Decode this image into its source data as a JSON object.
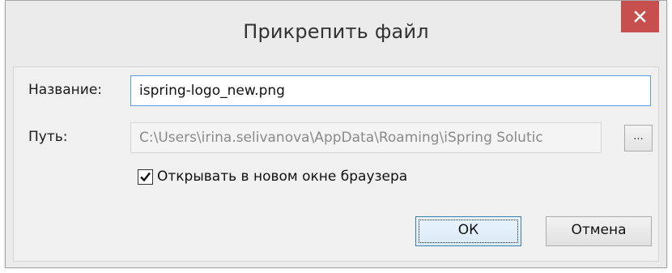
{
  "dialog": {
    "title": "Прикрепить файл",
    "close_icon": "close-icon",
    "accent_close": "#c7504e"
  },
  "form": {
    "name_label": "Название:",
    "name_value": "ispring-logo_new.png",
    "path_label": "Путь:",
    "path_value": "C:\\Users\\irina.selivanova\\AppData\\Roaming\\iSpring Solutic",
    "browse_label": "...",
    "open_new_window_label": "Открывать в новом окне браузера",
    "open_new_window_checked": true
  },
  "buttons": {
    "ok_label": "ОК",
    "cancel_label": "Отмена"
  }
}
